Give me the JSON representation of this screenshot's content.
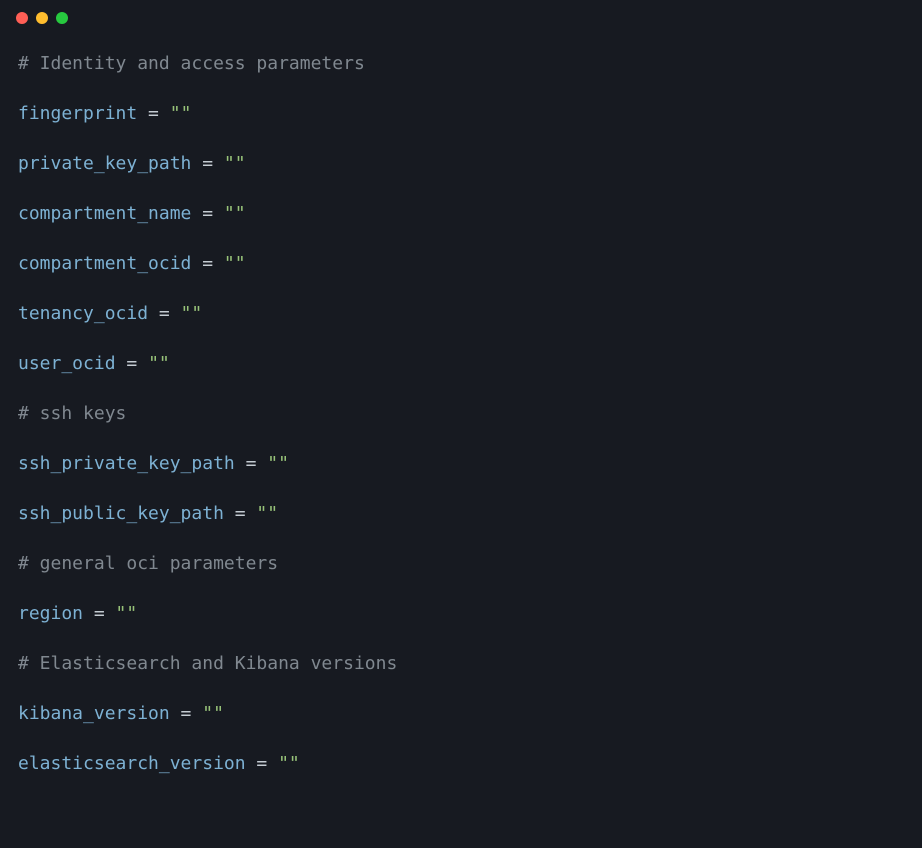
{
  "code": {
    "comments": {
      "identity": "# Identity and access parameters",
      "ssh": "# ssh keys",
      "general": "# general oci parameters",
      "es_kibana": "# Elasticsearch and Kibana versions"
    },
    "vars": {
      "fingerprint": "fingerprint",
      "private_key_path": "private_key_path",
      "compartment_name": "compartment_name",
      "compartment_ocid": "compartment_ocid",
      "tenancy_ocid": "tenancy_ocid",
      "user_ocid": "user_ocid",
      "ssh_private_key_path": "ssh_private_key_path",
      "ssh_public_key_path": "ssh_public_key_path",
      "region": "region",
      "kibana_version": "kibana_version",
      "elasticsearch_version": "elasticsearch_version"
    },
    "op": {
      "eq": " = "
    },
    "values": {
      "empty": "\"\""
    }
  }
}
